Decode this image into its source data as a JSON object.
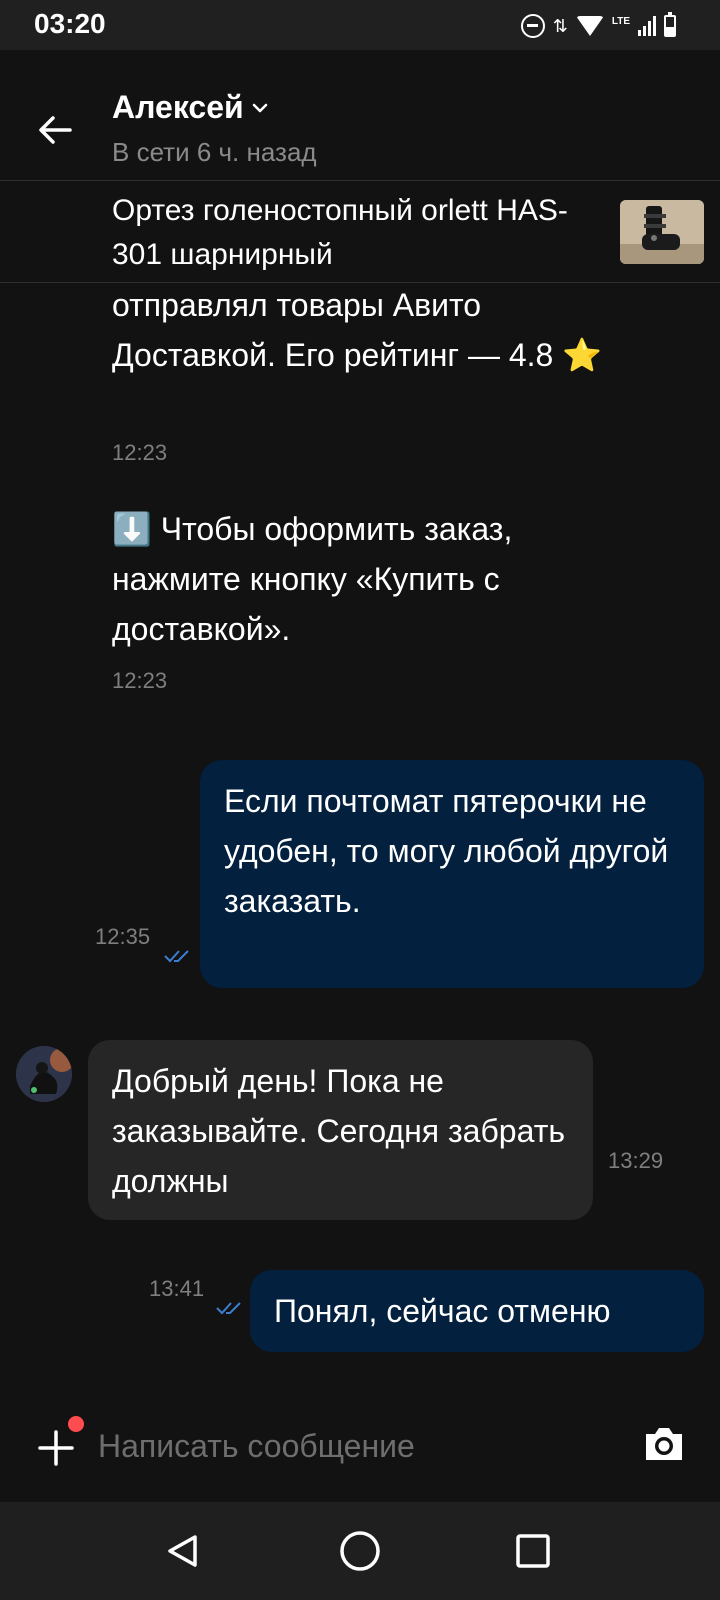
{
  "status_bar": {
    "time": "03:20",
    "network": "LTE"
  },
  "header": {
    "contact_name": "Алексей",
    "contact_status": "В сети 6 ч. назад"
  },
  "item": {
    "title": "Ортез голеностопный orlett HAS-301 шарнирный"
  },
  "messages": [
    {
      "type": "system",
      "text": "отправлял товары Авито Доставкой. Его рейтинг — 4.8 ⭐",
      "time": "12:23"
    },
    {
      "type": "system",
      "text": "⬇️ Чтобы оформить заказ, нажмите кнопку «Купить с доставкой».",
      "time": "12:23"
    },
    {
      "type": "outgoing",
      "text": "Если почтомат пятерочки не удобен, то могу любой другой заказать.",
      "time": "12:35",
      "status": "read"
    },
    {
      "type": "incoming",
      "text": "Добрый день! Пока не заказывайте. Сегодня забрать должны",
      "time": "13:29"
    },
    {
      "type": "outgoing",
      "text": "Понял, сейчас отменю",
      "time": "13:41",
      "status": "read"
    }
  ],
  "composer": {
    "placeholder": "Написать сообщение",
    "value": ""
  },
  "colors": {
    "background": "#121212",
    "outgoing_bubble": "#03203f",
    "incoming_bubble": "#262626",
    "read_ticks": "#3b7fd1",
    "notification_dot": "#ff4d4f"
  },
  "icons": {
    "back": "arrow-left-icon",
    "dropdown": "chevron-down-icon",
    "attach": "plus-icon",
    "camera": "camera-icon",
    "nav_back": "triangle-back-icon",
    "nav_home": "circle-home-icon",
    "nav_recents": "square-recents-icon"
  }
}
